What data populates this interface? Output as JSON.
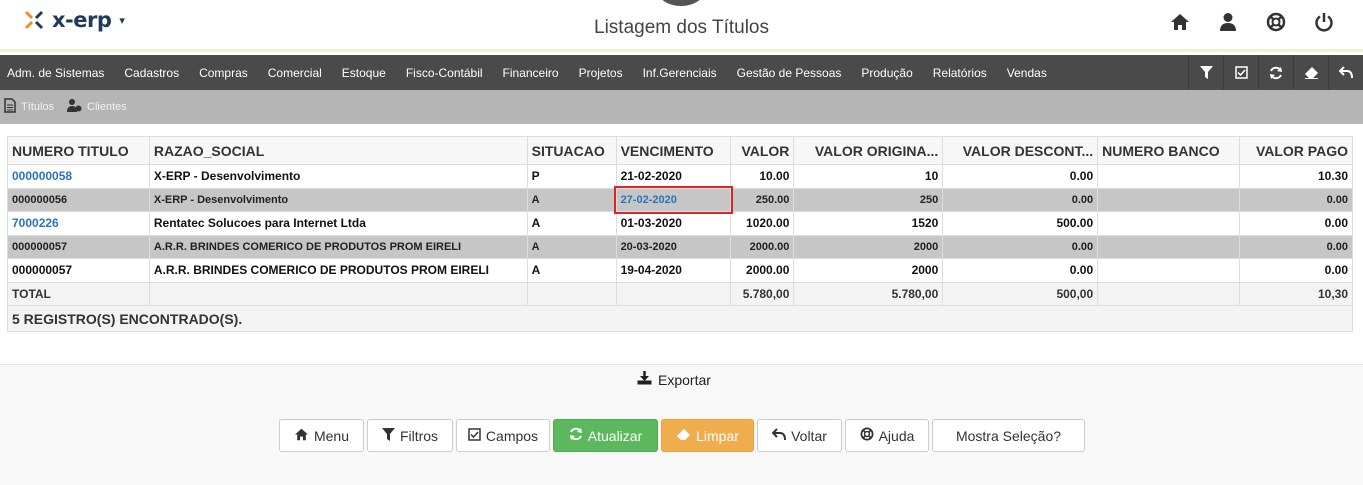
{
  "header": {
    "brand": "x-erp",
    "title": "Listagem dos Títulos",
    "icons": [
      "home-icon",
      "user-icon",
      "help-lifebuoy-icon",
      "power-icon"
    ]
  },
  "menu": {
    "items": [
      "Adm. de Sistemas",
      "Cadastros",
      "Compras",
      "Comercial",
      "Estoque",
      "Fisco-Contábil",
      "Financeiro",
      "Projetos",
      "Inf.Gerenciais",
      "Gestão de Pessoas",
      "Produção",
      "Relatórios",
      "Vendas"
    ],
    "tools": [
      "filter-icon",
      "checkbox-icon",
      "refresh-icon",
      "eraser-icon",
      "undo-icon"
    ]
  },
  "breadcrumbs": [
    {
      "label": "Títulos",
      "icon": "document-icon"
    },
    {
      "label": "Clientes",
      "icon": "user-money-icon"
    }
  ],
  "table": {
    "columns": [
      "NUMERO TITULO",
      "RAZAO_SOCIAL",
      "SITUACAO",
      "VENCIMENTO",
      "VALOR",
      "VALOR ORIGINA...",
      "VALOR DESCONT...",
      "NUMERO BANCO",
      "VALOR PAGO"
    ],
    "rows": [
      {
        "numero": "000000058",
        "razao": "X-ERP - Desenvolvimento",
        "situacao": "P",
        "vencimento": "21-02-2020",
        "valor": "10.00",
        "original": "10",
        "desconto": "0.00",
        "banco": "",
        "pago": "10.30"
      },
      {
        "numero": "000000056",
        "razao": "X-ERP - Desenvolvimento",
        "situacao": "A",
        "vencimento": "27-02-2020",
        "valor": "250.00",
        "original": "250",
        "desconto": "0.00",
        "banco": "",
        "pago": "0.00"
      },
      {
        "numero": "7000226",
        "razao": "Rentatec Solucoes para Internet Ltda",
        "situacao": "A",
        "vencimento": "01-03-2020",
        "valor": "1020.00",
        "original": "1520",
        "desconto": "500.00",
        "banco": "",
        "pago": "0.00"
      },
      {
        "numero": "000000057",
        "razao": "A.R.R. BRINDES COMERICO DE PRODUTOS PROM EIRELI",
        "situacao": "A",
        "vencimento": "20-03-2020",
        "valor": "2000.00",
        "original": "2000",
        "desconto": "0.00",
        "banco": "",
        "pago": "0.00"
      },
      {
        "numero": "000000057",
        "razao": "A.R.R. BRINDES COMERICO DE PRODUTOS PROM EIRELI",
        "situacao": "A",
        "vencimento": "19-04-2020",
        "valor": "2000.00",
        "original": "2000",
        "desconto": "0.00",
        "banco": "",
        "pago": "0.00"
      }
    ],
    "total": {
      "label": "TOTAL",
      "valor": "5.780,00",
      "original": "5.780,00",
      "desconto": "500,00",
      "pago": "10,30"
    },
    "footer": "5 REGISTRO(S) ENCONTRADO(S)."
  },
  "export_label": "Exportar",
  "buttons": [
    {
      "label": "Menu",
      "icon": "home-icon"
    },
    {
      "label": "Filtros",
      "icon": "filter-icon"
    },
    {
      "label": "Campos",
      "icon": "checkbox-icon"
    },
    {
      "label": "Atualizar",
      "icon": "refresh-icon"
    },
    {
      "label": "Limpar",
      "icon": "eraser-icon"
    },
    {
      "label": "Voltar",
      "icon": "undo-icon"
    },
    {
      "label": "Ajuda",
      "icon": "help-lifebuoy-icon"
    },
    {
      "label": "Mostra Seleção?",
      "icon": ""
    }
  ],
  "colors": {
    "menubar": "#4a4a4a",
    "crumbbar": "#b5b5b5",
    "link": "#2b73b9",
    "green": "#5cb85c",
    "orange": "#f0ad4e",
    "highlight": "#d62828"
  }
}
